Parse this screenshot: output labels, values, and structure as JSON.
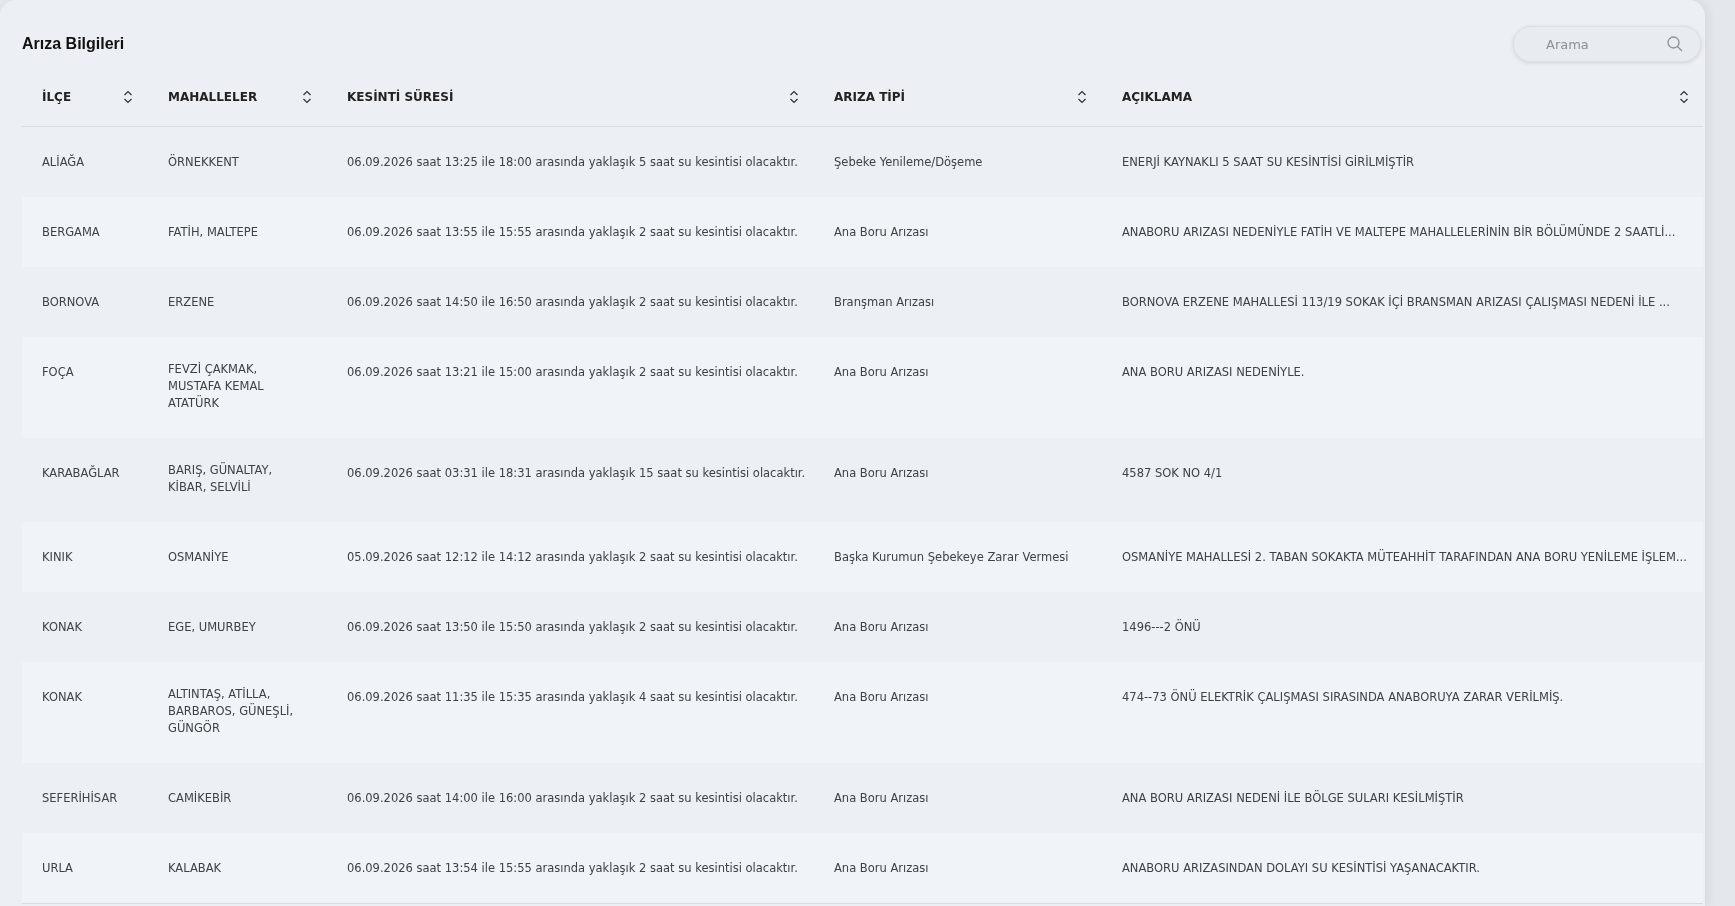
{
  "title": "Arıza Bilgileri",
  "search": {
    "placeholder": "Arama"
  },
  "table": {
    "columns": [
      {
        "label": "İLÇE",
        "sortable": true
      },
      {
        "label": "MAHALLELER",
        "sortable": true
      },
      {
        "label": "KESİNTİ SÜRESİ",
        "sortable": true
      },
      {
        "label": "ARIZA TİPİ",
        "sortable": true
      },
      {
        "label": "AÇIKLAMA",
        "sortable": true
      }
    ],
    "rows": [
      {
        "cells": [
          "ALİAĞA",
          "ÖRNEKKENT",
          "06.09.2026 saat 13:25 ile 18:00 arasında yaklaşık 5 saat su kesintisi olacaktır.",
          "Şebeke Yenileme/Döşeme",
          "ENERJİ KAYNAKLI 5 SAAT SU KESİNTİSİ GİRİLMİŞTİR"
        ]
      },
      {
        "cells": [
          "BERGAMA",
          "FATİH, MALTEPE",
          "06.09.2026 saat 13:55 ile 15:55 arasında yaklaşık 2 saat su kesintisi olacaktır.",
          "Ana Boru Arızası",
          "ANABORU ARIZASI NEDENİYLE FATİH VE MALTEPE MAHALLELERİNİN BİR BÖLÜMÜNDE 2 SAATLİ..."
        ]
      },
      {
        "cells": [
          "BORNOVA",
          "ERZENE",
          "06.09.2026 saat 14:50 ile 16:50 arasında yaklaşık 2 saat su kesintisi olacaktır.",
          "Branşman Arızası",
          "BORNOVA ERZENE MAHALLESİ 113/19 SOKAK İÇİ BRANSMAN ARIZASI ÇALIŞMASI NEDENİ İLE ..."
        ]
      },
      {
        "cells": [
          "FOÇA",
          "FEVZİ ÇAKMAK, MUSTAFA KEMAL ATATÜRK",
          "06.09.2026 saat 13:21 ile 15:00 arasında yaklaşık 2 saat su kesintisi olacaktır.",
          "Ana Boru Arızası",
          "ANA BORU ARIZASI NEDENİYLE."
        ]
      },
      {
        "cells": [
          "KARABAĞLAR",
          "BARIŞ, GÜNALTAY, KİBAR, SELVİLİ",
          "06.09.2026 saat 03:31 ile 18:31 arasında yaklaşık 15 saat su kesintisi olacaktır.",
          "Ana Boru Arızası",
          "4587 SOK NO 4/1"
        ]
      },
      {
        "cells": [
          "KINIK",
          "OSMANİYE",
          "05.09.2026 saat 12:12 ile 14:12 arasında yaklaşık 2 saat su kesintisi olacaktır.",
          "Başka Kurumun Şebekeye Zarar Vermesi",
          "OSMANİYE MAHALLESİ 2. TABAN SOKAKTA MÜTEAHHİT TARAFINDAN ANA BORU YENİLEME İŞLEM..."
        ]
      },
      {
        "cells": [
          "KONAK",
          "EGE, UMURBEY",
          "06.09.2026 saat 13:50 ile 15:50 arasında yaklaşık 2 saat su kesintisi olacaktır.",
          "Ana Boru Arızası",
          "1496---2 ÖNÜ"
        ]
      },
      {
        "cells": [
          "KONAK",
          "ALTINTAŞ, ATİLLA, BARBAROS, GÜNEŞLİ, GÜNGÖR",
          "06.09.2026 saat 11:35 ile 15:35 arasında yaklaşık 4 saat su kesintisi olacaktır.",
          "Ana Boru Arızası",
          "474--73 ÖNÜ ELEKTRİK ÇALIŞMASI SIRASINDA ANABORUYA ZARAR VERİLMİŞ."
        ]
      },
      {
        "cells": [
          "SEFERİHİSAR",
          "CAMİKEBİR",
          "06.09.2026 saat 14:00 ile 16:00 arasında yaklaşık 2 saat su kesintisi olacaktır.",
          "Ana Boru Arızası",
          "ANA BORU ARIZASI NEDENİ İLE BÖLGE SULARI KESİLMİŞTİR"
        ]
      },
      {
        "cells": [
          "URLA",
          "KALABAK",
          "06.09.2026 saat 13:54 ile 15:55 arasında yaklaşık 2 saat su kesintisi olacaktır.",
          "Ana Boru Arızası",
          "ANABORU ARIZASINDAN DOLAYI SU KESİNTİSİ YAŞANACAKTIR."
        ]
      }
    ]
  }
}
